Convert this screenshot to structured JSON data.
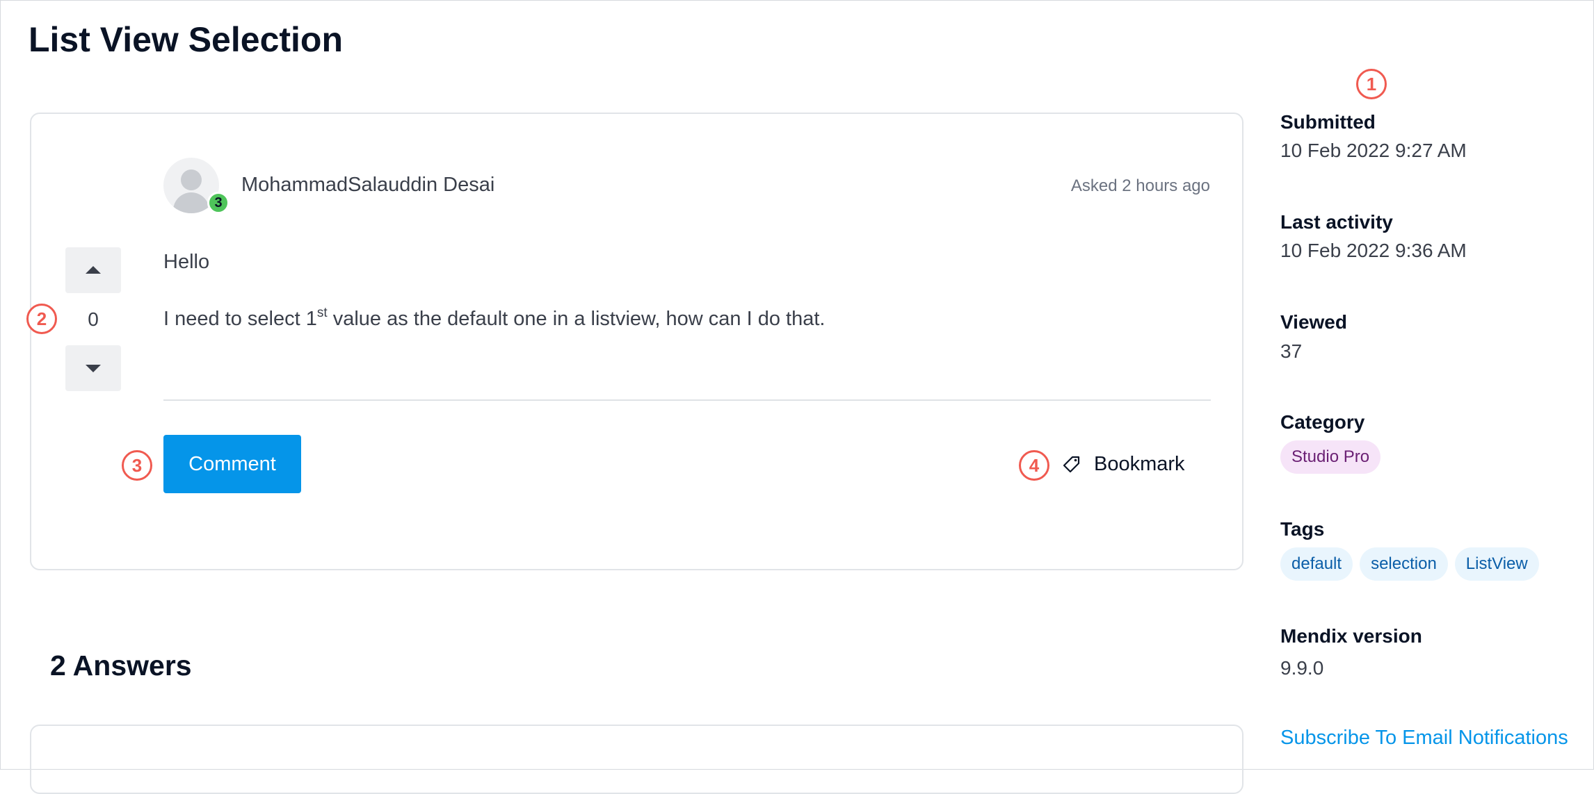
{
  "page": {
    "title": "List View Selection"
  },
  "question": {
    "author": "MohammadSalauddin Desai",
    "reputation_badge": "3",
    "asked": "Asked 2 hours ago",
    "votes": "0",
    "body_line1": "Hello",
    "body_line2_before": "I need to select 1",
    "body_line2_sup": "st",
    "body_line2_after": " value as the default one in a listview, how can I do that.",
    "comment_label": "Comment",
    "bookmark_label": "Bookmark"
  },
  "answers": {
    "title": "2 Answers"
  },
  "sidebar": {
    "submitted_label": "Submitted",
    "submitted_value": "10 Feb 2022 9:27 AM",
    "last_activity_label": "Last activity",
    "last_activity_value": "10 Feb 2022 9:36 AM",
    "viewed_label": "Viewed",
    "viewed_value": "37",
    "category_label": "Category",
    "category_value": "Studio Pro",
    "tags_label": "Tags",
    "tags": [
      "default",
      "selection",
      "ListView"
    ],
    "mendix_version_label": "Mendix version",
    "mendix_version_value": "9.9.0",
    "subscribe_link": "Subscribe To Email Notifications"
  },
  "annotations": [
    "1",
    "2",
    "3",
    "4"
  ],
  "colors": {
    "accent": "#0595e9",
    "marker": "#f05a50",
    "badge": "#4ec45a",
    "category_pill": "#f6e4f8",
    "tag_pill": "#e9f5fd"
  }
}
